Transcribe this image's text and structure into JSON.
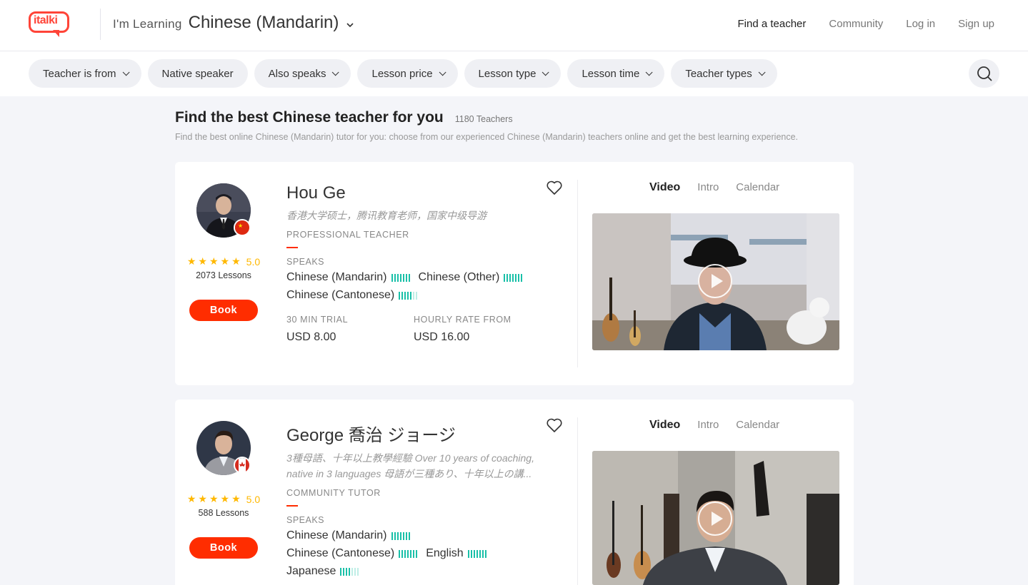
{
  "header": {
    "logo_text": "italki",
    "learning_prefix": "I'm Learning",
    "learning_language": "Chinese (Mandarin)",
    "nav": {
      "find_teacher": "Find a teacher",
      "community": "Community",
      "login": "Log in",
      "signup": "Sign up"
    }
  },
  "filters": [
    {
      "label": "Teacher is from",
      "dropdown": true
    },
    {
      "label": "Native speaker",
      "dropdown": false
    },
    {
      "label": "Also speaks",
      "dropdown": true
    },
    {
      "label": "Lesson price",
      "dropdown": true
    },
    {
      "label": "Lesson type",
      "dropdown": true
    },
    {
      "label": "Lesson time",
      "dropdown": true
    },
    {
      "label": "Teacher types",
      "dropdown": true
    }
  ],
  "page": {
    "title": "Find the best Chinese teacher for you",
    "count": "1180 Teachers",
    "subtitle": "Find the best online Chinese (Mandarin) tutor for you: choose from our experienced Chinese (Mandarin) teachers online and get the best learning experience."
  },
  "teachers": [
    {
      "name": "Hou Ge",
      "tagline": "香港大学硕士，腾讯教育老师，国家中级导游",
      "type": "PROFESSIONAL TEACHER",
      "rating": "5.0",
      "lessons": "2073 Lessons",
      "book": "Book",
      "flag_icon": "china-flag-icon",
      "speaks_label": "SPEAKS",
      "languages": [
        {
          "name": "Chinese (Mandarin)",
          "level": 7
        },
        {
          "name": "Chinese (Other)",
          "level": 7
        },
        {
          "name": "Chinese (Cantonese)",
          "level": 5
        }
      ],
      "trial_label": "30 MIN TRIAL",
      "trial_price": "USD 8.00",
      "hourly_label": "HOURLY RATE FROM",
      "hourly_price": "USD 16.00",
      "tabs": [
        "Video",
        "Intro",
        "Calendar"
      ]
    },
    {
      "name": "George 喬治 ジョージ",
      "tagline": "3種母語、十年以上教學經驗 Over 10 years of coaching, native in 3 languages 母語が三種あり、十年以上の講...",
      "type": "COMMUNITY TUTOR",
      "rating": "5.0",
      "lessons": "588 Lessons",
      "book": "Book",
      "flag_icon": "canada-flag-icon",
      "speaks_label": "SPEAKS",
      "languages": [
        {
          "name": "Chinese (Mandarin)",
          "level": 7
        },
        {
          "name": "Chinese (Cantonese)",
          "level": 7
        },
        {
          "name": "English",
          "level": 7
        },
        {
          "name": "Japanese",
          "level": 4
        }
      ],
      "tabs": [
        "Video",
        "Intro",
        "Calendar"
      ]
    }
  ],
  "colors": {
    "brand": "#ff4438",
    "book_button": "#ff2d00",
    "star": "#ffb800",
    "level_bar": "#19c0a8"
  }
}
